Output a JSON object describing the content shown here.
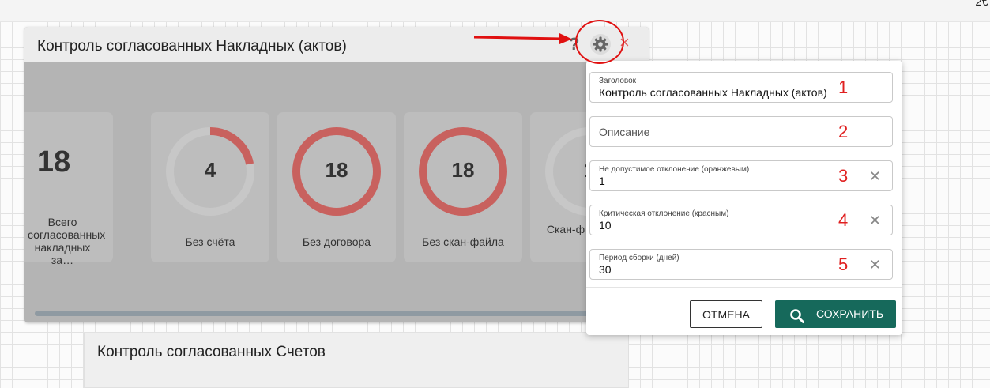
{
  "topbar": {
    "corner_text": "2€"
  },
  "widget": {
    "title": "Контроль согласованных Накладных (актов)",
    "help_glyph": "?",
    "close_glyph": "×",
    "cards": [
      {
        "value": "18",
        "label": "Всего согласованных накладных за…",
        "progress": null
      },
      {
        "value": "4",
        "label": "Без счёта",
        "progress": 0.22
      },
      {
        "value": "18",
        "label": "Без договора",
        "progress": 1.0
      },
      {
        "value": "18",
        "label": "Без скан-файла",
        "progress": 1.0
      },
      {
        "value": "1",
        "label": "Скан-ф соотв.до",
        "progress": 0.06
      }
    ]
  },
  "widget2": {
    "title": "Контроль согласованных Счетов"
  },
  "settings": {
    "fields": [
      {
        "label": "Заголовок",
        "value": "Контроль согласованных Накладных (актов)",
        "marker": "1",
        "clearable": false
      },
      {
        "placeholder": "Описание",
        "marker": "2",
        "clearable": false
      },
      {
        "label": "Не допустимое отклонение (оранжевым)",
        "value": "1",
        "marker": "3",
        "clearable": true
      },
      {
        "label": "Критическая отклонение (красным)",
        "value": "10",
        "marker": "4",
        "clearable": true
      },
      {
        "label": "Период сборки (дней)",
        "value": "30",
        "marker": "5",
        "clearable": true
      }
    ],
    "clear_glyph": "✕",
    "cancel_label": "ОТМЕНА",
    "save_label": "СОХРАНИТЬ"
  },
  "colors": {
    "accent": "#16695b",
    "donut_fill": "#c8615e",
    "donut_track": "#c7c7c7",
    "annotation": "#e01010"
  }
}
